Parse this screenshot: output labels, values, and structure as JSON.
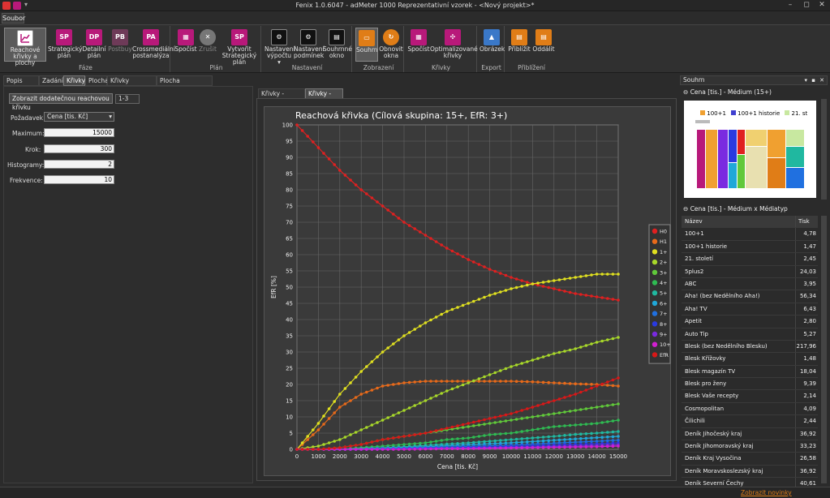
{
  "window": {
    "title": "Fenix 1.0.6047 - adMeter 1000 Reprezentativní vzorek - <Nový projekt>*"
  },
  "menu": {
    "file": "Soubor"
  },
  "ribbon": {
    "groups": [
      {
        "label": "Fáze",
        "buttons": [
          {
            "label": "Reachové\nkřivky a plochy",
            "icon": "chart-icon"
          },
          {
            "label": "Strategický\nplán",
            "icon": "SP"
          },
          {
            "label": "Detailní\nplán",
            "icon": "DP"
          },
          {
            "label": "Postbuy",
            "icon": "PB"
          },
          {
            "label": "Crossmediální\npostanalýza",
            "icon": "PA"
          }
        ]
      },
      {
        "label": "Plán",
        "buttons": [
          {
            "label": "Spočíst",
            "icon": "calc-icon"
          },
          {
            "label": "Zrušit",
            "icon": "cancel-icon"
          },
          {
            "label": "Vytvořit\nStrategický plán",
            "icon": "SP"
          }
        ]
      },
      {
        "label": "Nastavení",
        "buttons": [
          {
            "label": "Nastavení\nvýpočtu ▾"
          },
          {
            "label": "Nastavení\npodmínek"
          },
          {
            "label": "Souhrnné\nokno"
          }
        ]
      },
      {
        "label": "Zobrazení",
        "buttons": [
          {
            "label": "Souhrn"
          },
          {
            "label": "Obnovit\nokna"
          }
        ]
      },
      {
        "label": "Křivky",
        "buttons": [
          {
            "label": "Spočíst"
          },
          {
            "label": "Optimalizované\nkřivky"
          }
        ]
      },
      {
        "label": "Export",
        "buttons": [
          {
            "label": "Obrázek"
          }
        ]
      },
      {
        "label": "Přiblížení",
        "buttons": [
          {
            "label": "Přiblížit"
          },
          {
            "label": "Oddálit"
          }
        ]
      }
    ]
  },
  "left": {
    "tabs": [
      "Popis plánu",
      "Zadání",
      "Křivky",
      "Plocha",
      "Křivky kombinací",
      "Plocha (požadavek)"
    ],
    "extra_curve_button": "Zobrazit dodatečnou reachovou křivku",
    "extra_curve_value": "1-3",
    "pozadavek_label": "Požadavek:",
    "pozadavek_value": "Cena [tis. Kč]",
    "maximum_label": "Maximum:",
    "maximum_value": "15000",
    "krok_label": "Krok:",
    "krok_value": "300",
    "histogramy_label": "Histogramy:",
    "histogramy_value": "2",
    "frekvence_label": "Frekvence:",
    "frekvence_value": "10"
  },
  "charttabs": [
    "Křivky - tabulka",
    "Křivky - graf"
  ],
  "chart_data": {
    "type": "line",
    "title": "Reachová křivka (Cílová skupina: 15+, EfR: 3+)",
    "xlabel": "Cena [tis. Kč]",
    "ylabel": "EfR [%]",
    "xlim": [
      0,
      15000
    ],
    "ylim": [
      0,
      100
    ],
    "xticks": [
      0,
      1000,
      2000,
      3000,
      4000,
      5000,
      6000,
      7000,
      8000,
      9000,
      10000,
      11000,
      12000,
      13000,
      14000,
      15000
    ],
    "yticks": [
      0,
      5,
      10,
      15,
      20,
      25,
      30,
      35,
      40,
      45,
      50,
      55,
      60,
      65,
      70,
      75,
      80,
      85,
      90,
      95,
      100
    ],
    "grid": true,
    "legend": "right",
    "x": [
      0,
      1000,
      2000,
      3000,
      4000,
      5000,
      6000,
      7000,
      8000,
      9000,
      10000,
      11000,
      12000,
      13000,
      14000,
      15000
    ],
    "series": [
      {
        "name": "H0",
        "color": "#e02020",
        "values": [
          100,
          93,
          86,
          80,
          75,
          70,
          66,
          62,
          58.5,
          55.5,
          53,
          51,
          49.5,
          48,
          47,
          46
        ]
      },
      {
        "name": "H1",
        "color": "#e86a1a",
        "values": [
          0,
          6,
          13,
          17,
          19.5,
          20.5,
          21,
          21,
          21,
          21,
          21,
          20.8,
          20.5,
          20.2,
          20,
          19.5
        ]
      },
      {
        "name": "1+",
        "color": "#e0e020",
        "values": [
          0,
          8,
          17,
          24,
          30,
          35,
          39,
          42.5,
          45,
          47.5,
          49.5,
          51,
          52,
          53,
          54,
          54
        ]
      },
      {
        "name": "2+",
        "color": "#a8d82a",
        "values": [
          0,
          1,
          3,
          6,
          9,
          12,
          15,
          18,
          20.5,
          23,
          25.5,
          27.5,
          29.5,
          31,
          33,
          34.5
        ]
      },
      {
        "name": "3+",
        "color": "#60c83a",
        "values": [
          0,
          0,
          0.5,
          1.5,
          3,
          4,
          5,
          6,
          7,
          8,
          9,
          10,
          11,
          12,
          13,
          14
        ]
      },
      {
        "name": "4+",
        "color": "#2fba52",
        "values": [
          0,
          0,
          0,
          0.5,
          1,
          1.5,
          2,
          3,
          3.5,
          4.5,
          5,
          6,
          7,
          7.5,
          8,
          9
        ]
      },
      {
        "name": "5+",
        "color": "#20b8a0",
        "values": [
          0,
          0,
          0,
          0.2,
          0.5,
          0.8,
          1.2,
          1.6,
          2,
          2.5,
          3,
          3.5,
          4,
          4.6,
          5,
          5.5
        ]
      },
      {
        "name": "6+",
        "color": "#20a8d8",
        "values": [
          0,
          0,
          0,
          0.1,
          0.3,
          0.5,
          0.8,
          1.1,
          1.4,
          1.7,
          2,
          2.4,
          2.8,
          3.2,
          3.6,
          4
        ]
      },
      {
        "name": "7+",
        "color": "#2070e0",
        "values": [
          0,
          0,
          0,
          0,
          0.2,
          0.3,
          0.5,
          0.7,
          0.9,
          1.1,
          1.3,
          1.6,
          1.9,
          2.2,
          2.5,
          2.8
        ]
      },
      {
        "name": "8+",
        "color": "#2a3ae0",
        "values": [
          0,
          0,
          0,
          0,
          0.1,
          0.2,
          0.3,
          0.4,
          0.6,
          0.7,
          0.9,
          1.1,
          1.3,
          1.5,
          1.7,
          2
        ]
      },
      {
        "name": "9+",
        "color": "#7a2ae0",
        "values": [
          0,
          0,
          0,
          0,
          0,
          0.1,
          0.2,
          0.3,
          0.4,
          0.5,
          0.6,
          0.7,
          0.9,
          1,
          1.2,
          1.4
        ]
      },
      {
        "name": "10+",
        "color": "#d020d0",
        "values": [
          0,
          0,
          0,
          0,
          0,
          0,
          0.1,
          0.2,
          0.2,
          0.3,
          0.4,
          0.5,
          0.6,
          0.7,
          0.8,
          1
        ]
      },
      {
        "name": "EfR",
        "color": "#d81818",
        "values": [
          0,
          0,
          0.5,
          1.5,
          3,
          4,
          5,
          6.5,
          8,
          9.5,
          11,
          13,
          15,
          17,
          19.5,
          22
        ]
      }
    ]
  },
  "souhrn": {
    "title": "Souhrn",
    "section1": "Cena [tis.] - Médium (15+)",
    "legend": [
      {
        "label": "100+1",
        "color": "#f0a030"
      },
      {
        "label": "100+1 historie",
        "color": "#4040d0"
      },
      {
        "label": "21. st",
        "color": "#e0f0b0"
      }
    ],
    "section2": "Cena [tis.] - Médium x Médiatyp",
    "col_name": "Název",
    "col_tisk": "Tisk",
    "rows": [
      [
        "100+1",
        "4,78"
      ],
      [
        "100+1 historie",
        "1,47"
      ],
      [
        "21. století",
        "2,45"
      ],
      [
        "5plus2",
        "24,03"
      ],
      [
        "ABC",
        "3,95"
      ],
      [
        "Aha! (bez Nedělního Aha!)",
        "56,34"
      ],
      [
        "Aha! TV",
        "6,43"
      ],
      [
        "Apetit",
        "2,80"
      ],
      [
        "Auto Tip",
        "5,27"
      ],
      [
        "Blesk (bez Nedělního Blesku)",
        "217,96"
      ],
      [
        "Blesk Křížovky",
        "1,48"
      ],
      [
        "Blesk magazín TV",
        "18,04"
      ],
      [
        "Blesk pro ženy",
        "9,39"
      ],
      [
        "Blesk Vaše recepty",
        "2,14"
      ],
      [
        "Cosmopolitan",
        "4,09"
      ],
      [
        "Čilichili",
        "2,44"
      ],
      [
        "Deník Jihočeský kraj",
        "36,92"
      ],
      [
        "Deník Jihomoravský kraj",
        "33,23"
      ],
      [
        "Deník Kraj Vysočina",
        "26,58"
      ],
      [
        "Deník Moravskoslezský kraj",
        "36,92"
      ],
      [
        "Deník Severní Čechy",
        "40,61"
      ]
    ]
  },
  "status": {
    "news": "Zobrazit novinky"
  }
}
